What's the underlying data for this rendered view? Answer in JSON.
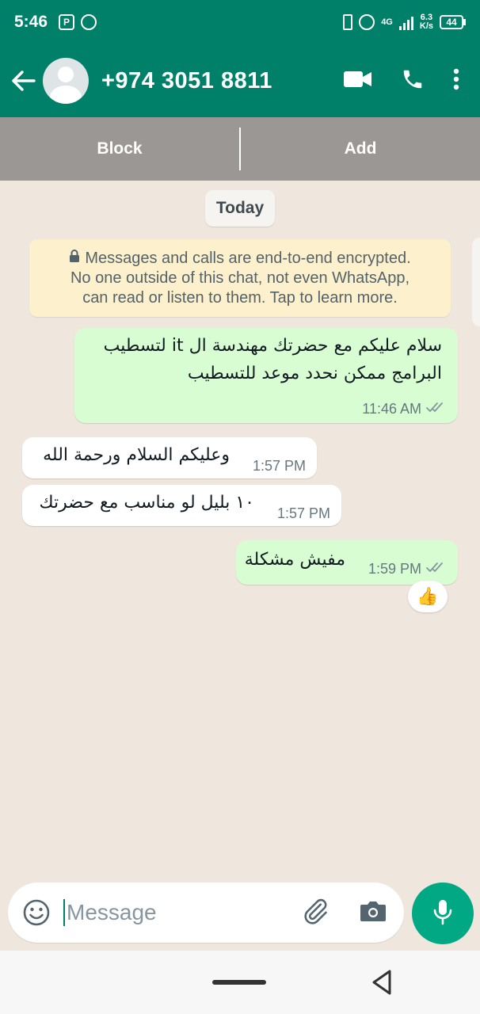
{
  "status_bar": {
    "time": "5:46",
    "network_type": "4G",
    "speed_value": "6.3",
    "speed_unit": "K/s",
    "battery": "44"
  },
  "header": {
    "title": "+974 3051 8811"
  },
  "actions": {
    "block_label": "Block",
    "add_label": "Add"
  },
  "chat": {
    "date_label": "Today",
    "encryption_notice": {
      "line1": "Messages and calls are end-to-end encrypted.",
      "line2": "No one outside of this chat, not even WhatsApp,",
      "line3": "can read or listen to them. Tap to learn more."
    },
    "messages": [
      {
        "direction": "outgoing",
        "line1": "سلام عليكم مع حضرتك مهندسة ال it لتسطيب",
        "line2": "البرامج ممكن نحدد موعد للتسطيب",
        "time": "11:46 AM",
        "status": "read"
      },
      {
        "direction": "incoming",
        "text": "وعليكم السلام ورحمة الله",
        "time": "1:57 PM"
      },
      {
        "direction": "incoming",
        "text": "١٠ بليل لو مناسب مع حضرتك",
        "time": "1:57 PM"
      },
      {
        "direction": "outgoing",
        "text": "مفيش مشكلة",
        "time": "1:59 PM",
        "status": "read",
        "reaction": "👍"
      }
    ]
  },
  "input": {
    "placeholder": "Message"
  },
  "colors": {
    "primary": "#008069",
    "mic_button": "#00a884",
    "outgoing_bubble": "#d9fdd3",
    "incoming_bubble": "#ffffff",
    "notice_background": "#fdf0cc",
    "action_bar": "#9a9794"
  },
  "icons": [
    "back-arrow-icon",
    "avatar-icon",
    "video-call-icon",
    "phone-icon",
    "more-options-icon",
    "lock-icon",
    "double-check-icon",
    "emoji-icon",
    "attach-icon",
    "camera-icon",
    "mic-icon"
  ]
}
